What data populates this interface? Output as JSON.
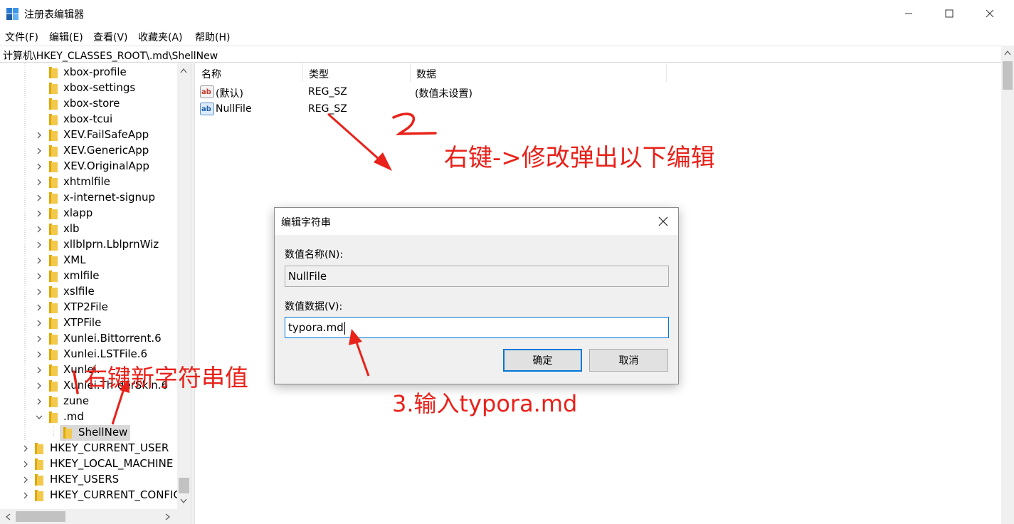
{
  "window": {
    "title": "注册表编辑器",
    "minimize_icon": "minimize-icon",
    "maximize_icon": "maximize-icon",
    "close_icon": "close-icon"
  },
  "menu": [
    "文件(F)",
    "编辑(E)",
    "查看(V)",
    "收藏夹(A)",
    "帮助(H)"
  ],
  "address": "计算机\\HKEY_CLASSES_ROOT\\.md\\ShellNew",
  "tree": {
    "items": [
      {
        "label": "xbox-profile",
        "arrow": false
      },
      {
        "label": "xbox-settings",
        "arrow": false
      },
      {
        "label": "xbox-store",
        "arrow": false
      },
      {
        "label": "xbox-tcui",
        "arrow": false
      },
      {
        "label": "XEV.FailSafeApp",
        "arrow": true
      },
      {
        "label": "XEV.GenericApp",
        "arrow": true
      },
      {
        "label": "XEV.OriginalApp",
        "arrow": true
      },
      {
        "label": "xhtmlfile",
        "arrow": true
      },
      {
        "label": "x-internet-signup",
        "arrow": true
      },
      {
        "label": "xlapp",
        "arrow": true
      },
      {
        "label": "xlb",
        "arrow": true
      },
      {
        "label": "xllblprn.LblprnWiz",
        "arrow": true
      },
      {
        "label": "XML",
        "arrow": true
      },
      {
        "label": "xmlfile",
        "arrow": true
      },
      {
        "label": "xslfile",
        "arrow": true
      },
      {
        "label": "XTP2File",
        "arrow": true
      },
      {
        "label": "XTPFile",
        "arrow": true
      },
      {
        "label": "Xunlei.Bittorrent.6",
        "arrow": true
      },
      {
        "label": "Xunlei.LSTFile.6",
        "arrow": true
      },
      {
        "label": "Xunlei.",
        "arrow": true
      },
      {
        "label": "Xunlei.Th",
        "arrow": true
      },
      {
        "label": "zune",
        "arrow": true
      },
      {
        "label": ".md",
        "arrow": "expanded"
      },
      {
        "label": "ShellNew",
        "arrow": false,
        "selected": true
      },
      {
        "label": "HKEY_CURRENT_USER",
        "arrow": true,
        "root": true
      },
      {
        "label": "HKEY_LOCAL_MACHINE",
        "arrow": true,
        "root": true
      },
      {
        "label": "HKEY_USERS",
        "arrow": true,
        "root": true
      },
      {
        "label": "HKEY_CURRENT_CONFIG",
        "arrow": true,
        "root": true
      }
    ],
    "tail_6": "derSkin.6",
    "folder_icon": "folder-icon"
  },
  "list": {
    "columns": [
      "名称",
      "类型",
      "数据"
    ],
    "rows": [
      {
        "name": "(默认)",
        "type": "REG_SZ",
        "data": "(数值未设置)",
        "icon": "string-value-icon"
      },
      {
        "name": "NullFile",
        "type": "REG_SZ",
        "data": "",
        "icon": "string-value-icon"
      }
    ]
  },
  "dialog": {
    "title": "编辑字符串",
    "name_label": "数值名称(N):",
    "name_value": "NullFile",
    "data_label": "数值数据(V):",
    "data_value": "typora.md",
    "ok_label": "确定",
    "cancel_label": "取消"
  },
  "annotations": {
    "step1": "右键新字符串值",
    "step2": "右键->修改弹出以下编辑",
    "step3": "3.输入typora.md",
    "color": "#e8221a"
  },
  "colors": {
    "selection": "#d9d9d9",
    "focus_border": "#0078d7",
    "folder": "#f2c94c"
  }
}
